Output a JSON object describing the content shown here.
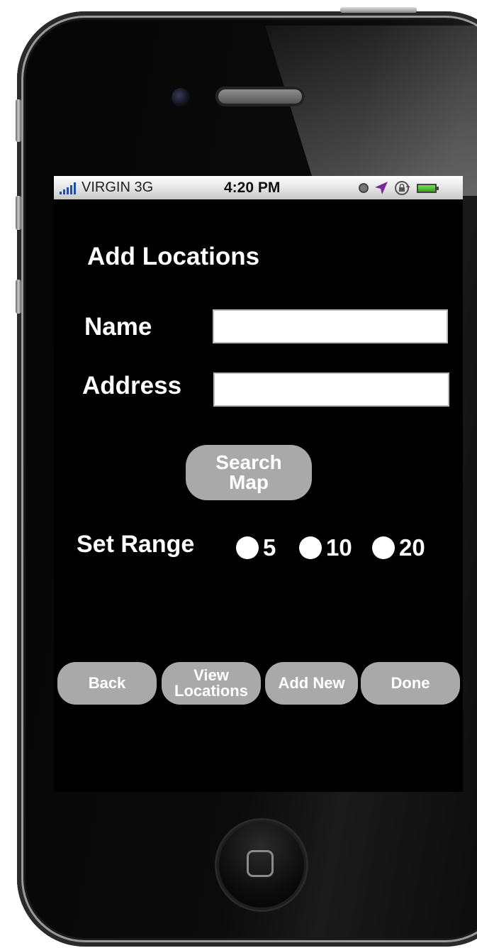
{
  "status_bar": {
    "carrier": "VIRGIN 3G",
    "time": "4:20 PM",
    "icons": [
      "signal-icon",
      "alarm-icon",
      "location-arrow-icon",
      "rotation-lock-icon",
      "battery-icon"
    ]
  },
  "screen": {
    "title": "Add Locations",
    "name_label": "Name",
    "name_value": "",
    "address_label": "Address",
    "address_value": "",
    "search_button": {
      "line1": "Search",
      "line2": "Map"
    },
    "range_label": "Set Range",
    "range_options": [
      "5",
      "10",
      "20"
    ]
  },
  "bottom_bar": {
    "back": "Back",
    "view_locations_line1": "View",
    "view_locations_line2": "Locations",
    "add_new": "Add New",
    "done": "Done"
  },
  "colors": {
    "screen_background": "#000000",
    "button_gray": "#a9a9a9",
    "text_white": "#ffffff",
    "signal_blue": "#1f4fa8",
    "battery_green": "#4cc933"
  }
}
